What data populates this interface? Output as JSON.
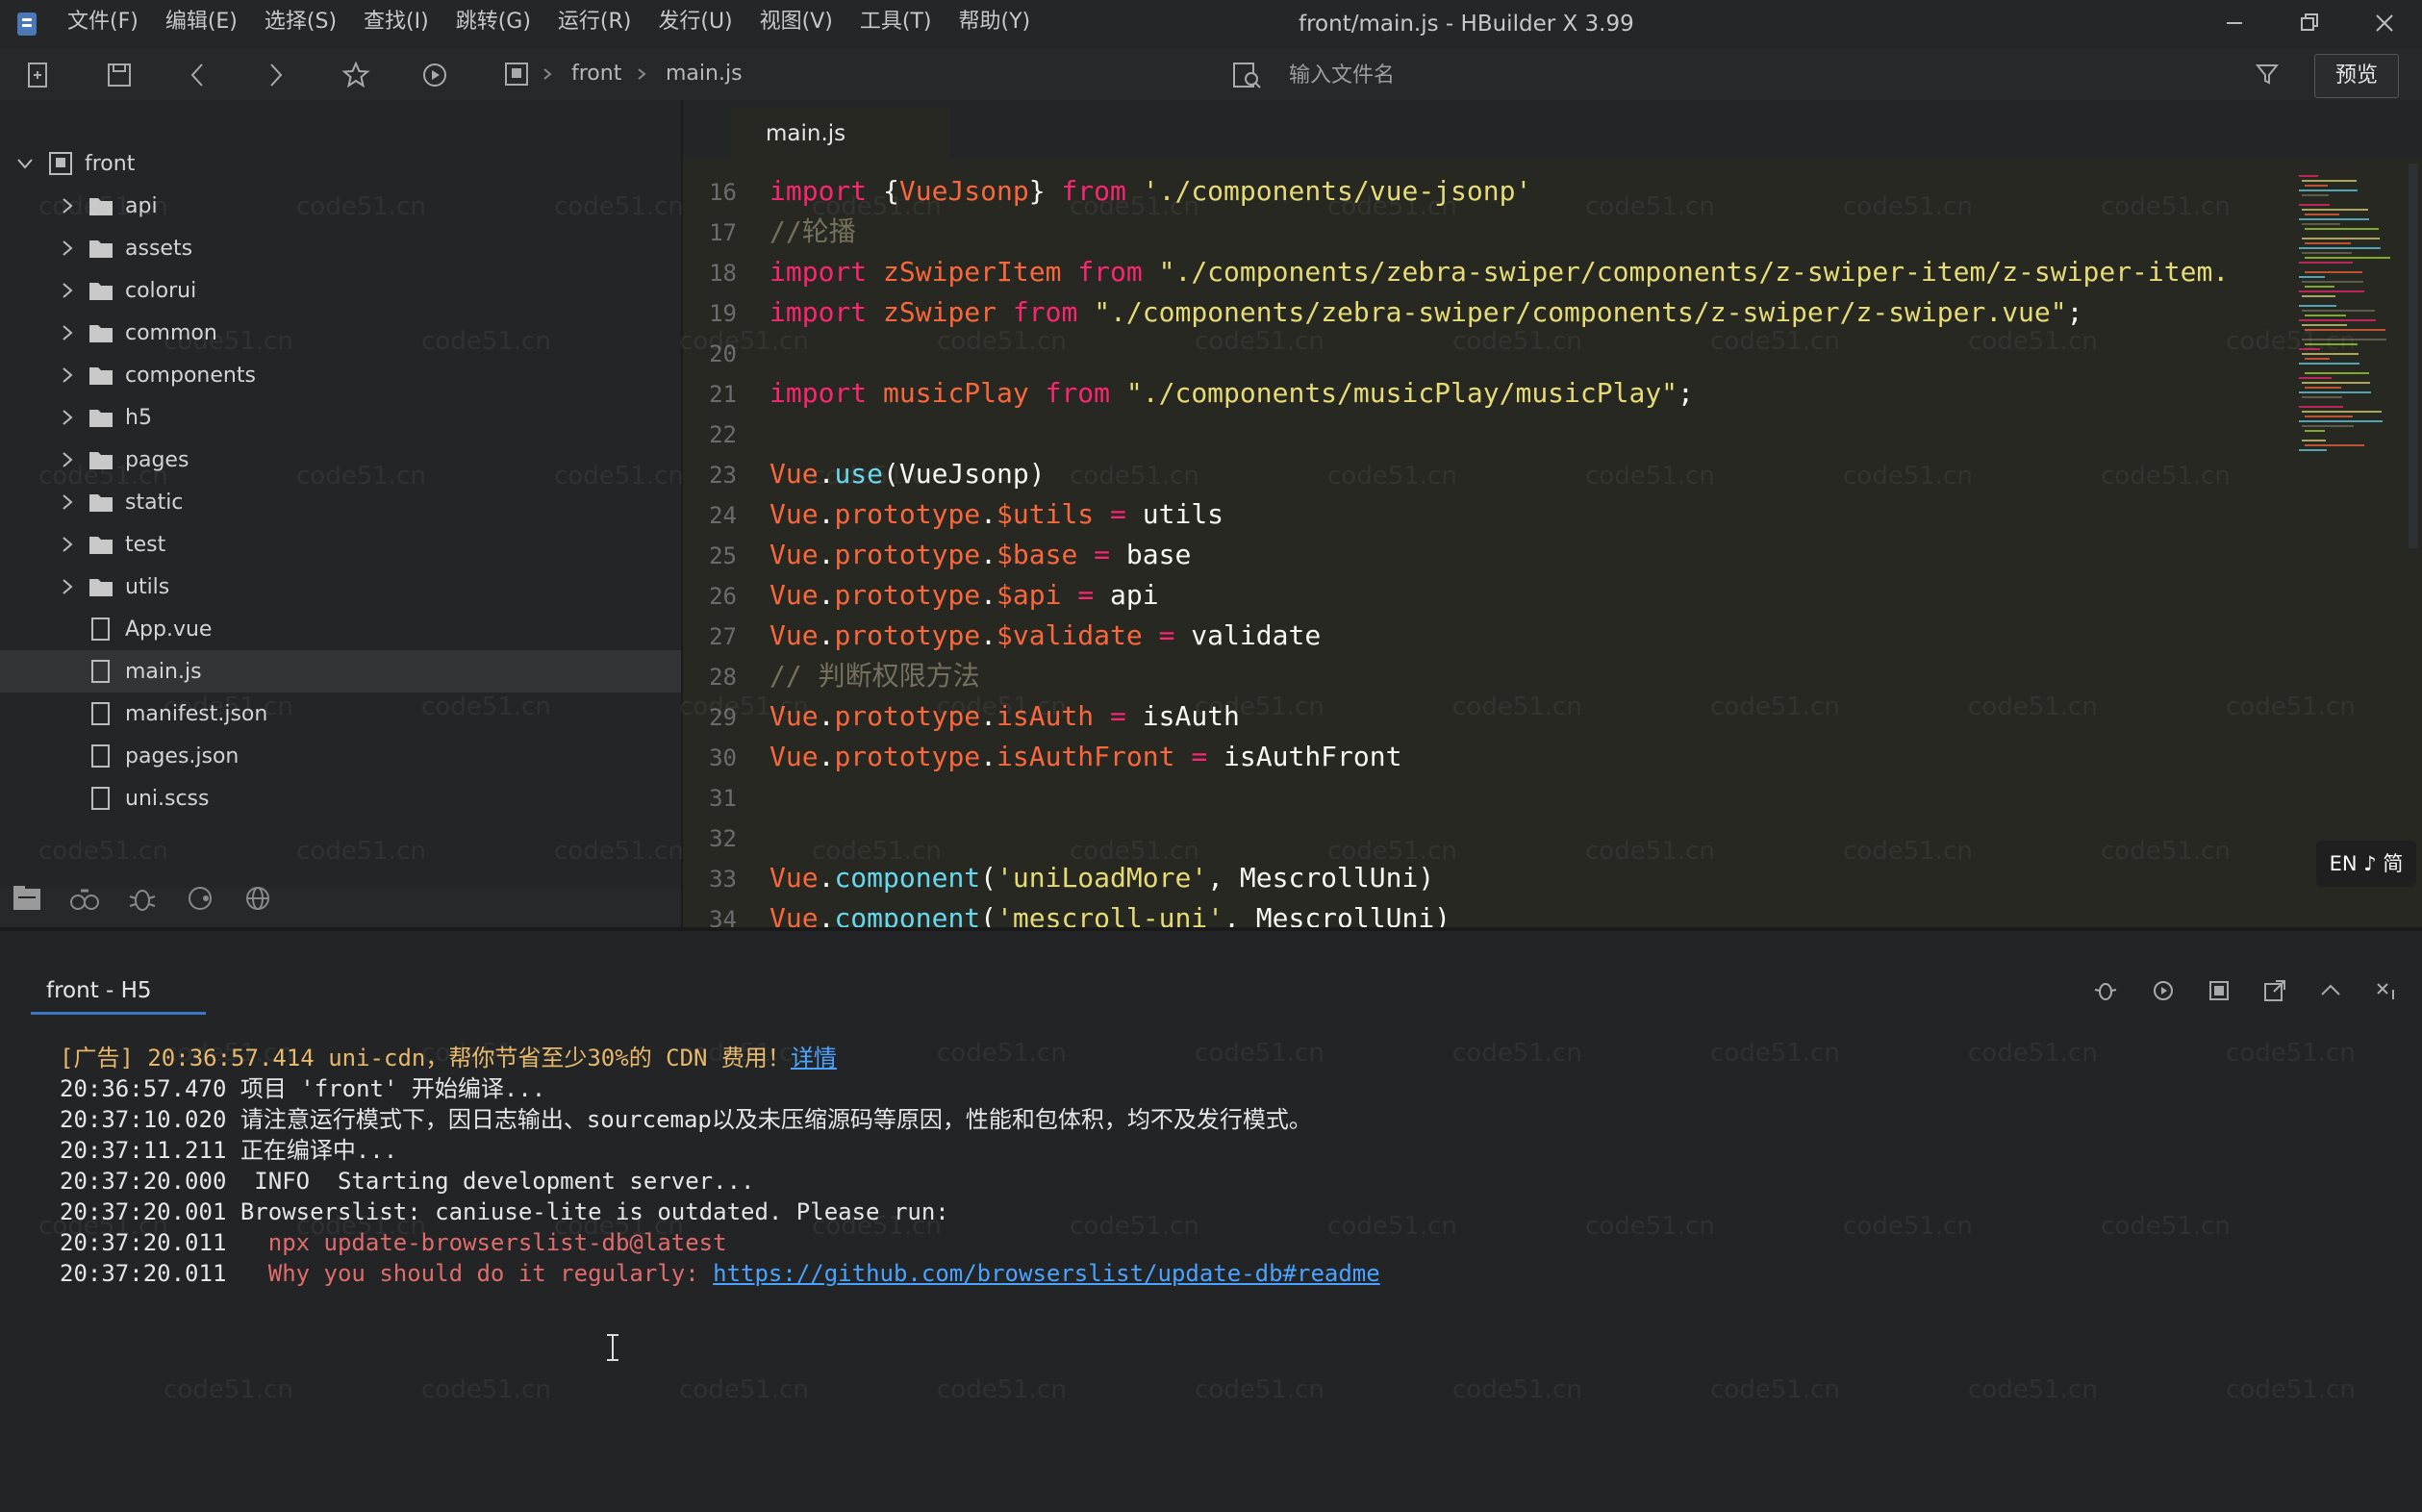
{
  "window": {
    "title": "front/main.js - HBuilder X 3.99",
    "menu": [
      "文件(F)",
      "编辑(E)",
      "选择(S)",
      "查找(I)",
      "跳转(G)",
      "运行(R)",
      "发行(U)",
      "视图(V)",
      "工具(T)",
      "帮助(Y)"
    ]
  },
  "toolbar": {
    "breadcrumb": [
      "front",
      "main.js"
    ],
    "file_search_placeholder": "输入文件名",
    "preview_label": "预览"
  },
  "project_tree": {
    "root": "front",
    "folders": [
      "api",
      "assets",
      "colorui",
      "common",
      "components",
      "h5",
      "pages",
      "static",
      "test",
      "utils"
    ],
    "files": [
      {
        "name": "App.vue",
        "icon": "vue-file-icon"
      },
      {
        "name": "main.js",
        "icon": "js-file-icon",
        "selected": true
      },
      {
        "name": "manifest.json",
        "icon": "settings-file-icon"
      },
      {
        "name": "pages.json",
        "icon": "json-file-icon"
      },
      {
        "name": "uni.scss",
        "icon": "scss-file-icon"
      }
    ]
  },
  "editor": {
    "tab": "main.js",
    "lines": [
      {
        "n": "16",
        "tokens": [
          [
            "k",
            "import"
          ],
          [
            "p",
            " {"
          ],
          [
            "v",
            "VueJsonp"
          ],
          [
            "p",
            "} "
          ],
          [
            "k",
            "from"
          ],
          [
            "p",
            " "
          ],
          [
            "s",
            "'./components/vue-jsonp'"
          ]
        ]
      },
      {
        "n": "17",
        "tokens": [
          [
            "c",
            "//轮播"
          ]
        ]
      },
      {
        "n": "18",
        "tokens": [
          [
            "k",
            "import"
          ],
          [
            "p",
            " "
          ],
          [
            "v",
            "zSwiperItem"
          ],
          [
            "p",
            " "
          ],
          [
            "k",
            "from"
          ],
          [
            "p",
            " "
          ],
          [
            "s",
            "\"./components/zebra-swiper/components/z-swiper-item/z-swiper-item."
          ]
        ]
      },
      {
        "n": "19",
        "tokens": [
          [
            "k",
            "import"
          ],
          [
            "p",
            " "
          ],
          [
            "v",
            "zSwiper"
          ],
          [
            "p",
            " "
          ],
          [
            "k",
            "from"
          ],
          [
            "p",
            " "
          ],
          [
            "s",
            "\"./components/zebra-swiper/components/z-swiper/z-swiper.vue\""
          ],
          [
            "p",
            ";"
          ]
        ]
      },
      {
        "n": "20",
        "tokens": []
      },
      {
        "n": "21",
        "tokens": [
          [
            "k",
            "import"
          ],
          [
            "p",
            " "
          ],
          [
            "v",
            "musicPlay"
          ],
          [
            "p",
            " "
          ],
          [
            "k",
            "from"
          ],
          [
            "p",
            " "
          ],
          [
            "s",
            "\"./components/musicPlay/musicPlay\""
          ],
          [
            "p",
            ";"
          ]
        ]
      },
      {
        "n": "22",
        "tokens": []
      },
      {
        "n": "23",
        "tokens": [
          [
            "v",
            "Vue"
          ],
          [
            "p",
            "."
          ],
          [
            "f",
            "use"
          ],
          [
            "p",
            "(VueJsonp)"
          ]
        ]
      },
      {
        "n": "24",
        "tokens": [
          [
            "v",
            "Vue"
          ],
          [
            "p",
            "."
          ],
          [
            "v",
            "prototype"
          ],
          [
            "p",
            "."
          ],
          [
            "v",
            "$utils"
          ],
          [
            "p",
            " "
          ],
          [
            "k",
            "="
          ],
          [
            "p",
            " utils"
          ]
        ]
      },
      {
        "n": "25",
        "tokens": [
          [
            "v",
            "Vue"
          ],
          [
            "p",
            "."
          ],
          [
            "v",
            "prototype"
          ],
          [
            "p",
            "."
          ],
          [
            "v",
            "$base"
          ],
          [
            "p",
            " "
          ],
          [
            "k",
            "="
          ],
          [
            "p",
            " base"
          ]
        ]
      },
      {
        "n": "26",
        "tokens": [
          [
            "v",
            "Vue"
          ],
          [
            "p",
            "."
          ],
          [
            "v",
            "prototype"
          ],
          [
            "p",
            "."
          ],
          [
            "v",
            "$api"
          ],
          [
            "p",
            " "
          ],
          [
            "k",
            "="
          ],
          [
            "p",
            " api"
          ]
        ]
      },
      {
        "n": "27",
        "tokens": [
          [
            "v",
            "Vue"
          ],
          [
            "p",
            "."
          ],
          [
            "v",
            "prototype"
          ],
          [
            "p",
            "."
          ],
          [
            "v",
            "$validate"
          ],
          [
            "p",
            " "
          ],
          [
            "k",
            "="
          ],
          [
            "p",
            " validate"
          ]
        ]
      },
      {
        "n": "28",
        "tokens": [
          [
            "c",
            "// 判断权限方法"
          ]
        ]
      },
      {
        "n": "29",
        "tokens": [
          [
            "v",
            "Vue"
          ],
          [
            "p",
            "."
          ],
          [
            "v",
            "prototype"
          ],
          [
            "p",
            "."
          ],
          [
            "v",
            "isAuth"
          ],
          [
            "p",
            " "
          ],
          [
            "k",
            "="
          ],
          [
            "p",
            " isAuth"
          ]
        ]
      },
      {
        "n": "30",
        "tokens": [
          [
            "v",
            "Vue"
          ],
          [
            "p",
            "."
          ],
          [
            "v",
            "prototype"
          ],
          [
            "p",
            "."
          ],
          [
            "v",
            "isAuthFront"
          ],
          [
            "p",
            " "
          ],
          [
            "k",
            "="
          ],
          [
            "p",
            " isAuthFront"
          ]
        ]
      },
      {
        "n": "31",
        "tokens": []
      },
      {
        "n": "32",
        "tokens": []
      },
      {
        "n": "33",
        "tokens": [
          [
            "v",
            "Vue"
          ],
          [
            "p",
            "."
          ],
          [
            "f",
            "component"
          ],
          [
            "p",
            "("
          ],
          [
            "s",
            "'uniLoadMore'"
          ],
          [
            "p",
            ", MescrollUni)"
          ]
        ]
      },
      {
        "n": "34",
        "tokens": [
          [
            "v",
            "Vue"
          ],
          [
            "p",
            "."
          ],
          [
            "f",
            "component"
          ],
          [
            "p",
            "("
          ],
          [
            "s",
            "'mescroll-uni'"
          ],
          [
            "p",
            ", MescrollUni)"
          ]
        ]
      }
    ],
    "ime_badge": "EN ♪ 简"
  },
  "console": {
    "tab": "front - H5",
    "lines": [
      {
        "time": "[广告] 20:36:57.414",
        "segments": [
          [
            "ad",
            " uni-cdn，帮你节省至少30%的 CDN 费用！"
          ],
          [
            "link",
            "详情"
          ]
        ]
      },
      {
        "time": "20:36:57.470",
        "segments": [
          [
            "plain",
            " 项目 'front' 开始编译..."
          ]
        ]
      },
      {
        "time": "20:37:10.020",
        "segments": [
          [
            "plain",
            " 请注意运行模式下，因日志输出、sourcemap以及未压缩源码等原因，性能和包体积，均不及发行模式。"
          ]
        ]
      },
      {
        "time": "20:37:11.211",
        "segments": [
          [
            "plain",
            " 正在编译中..."
          ]
        ]
      },
      {
        "time": "20:37:20.000",
        "segments": [
          [
            "plain",
            "  INFO  Starting development server..."
          ]
        ]
      },
      {
        "time": "20:37:20.001",
        "segments": [
          [
            "plain",
            " Browserslist: caniuse-lite is outdated. Please run:"
          ]
        ]
      },
      {
        "time": "20:37:20.011",
        "segments": [
          [
            "red",
            "   npx update-browserslist-db@latest"
          ]
        ]
      },
      {
        "time": "20:37:20.011",
        "segments": [
          [
            "red",
            "   Why you should do it regularly: "
          ],
          [
            "link",
            "https://github.com/browserslist/update-db#readme"
          ]
        ]
      }
    ]
  },
  "watermark": "code51.cn",
  "colors": {
    "keyword": "#f92672",
    "string": "#e6db74",
    "comment": "#75715e",
    "variable": "#f9673d",
    "link": "#4aa3ff"
  }
}
